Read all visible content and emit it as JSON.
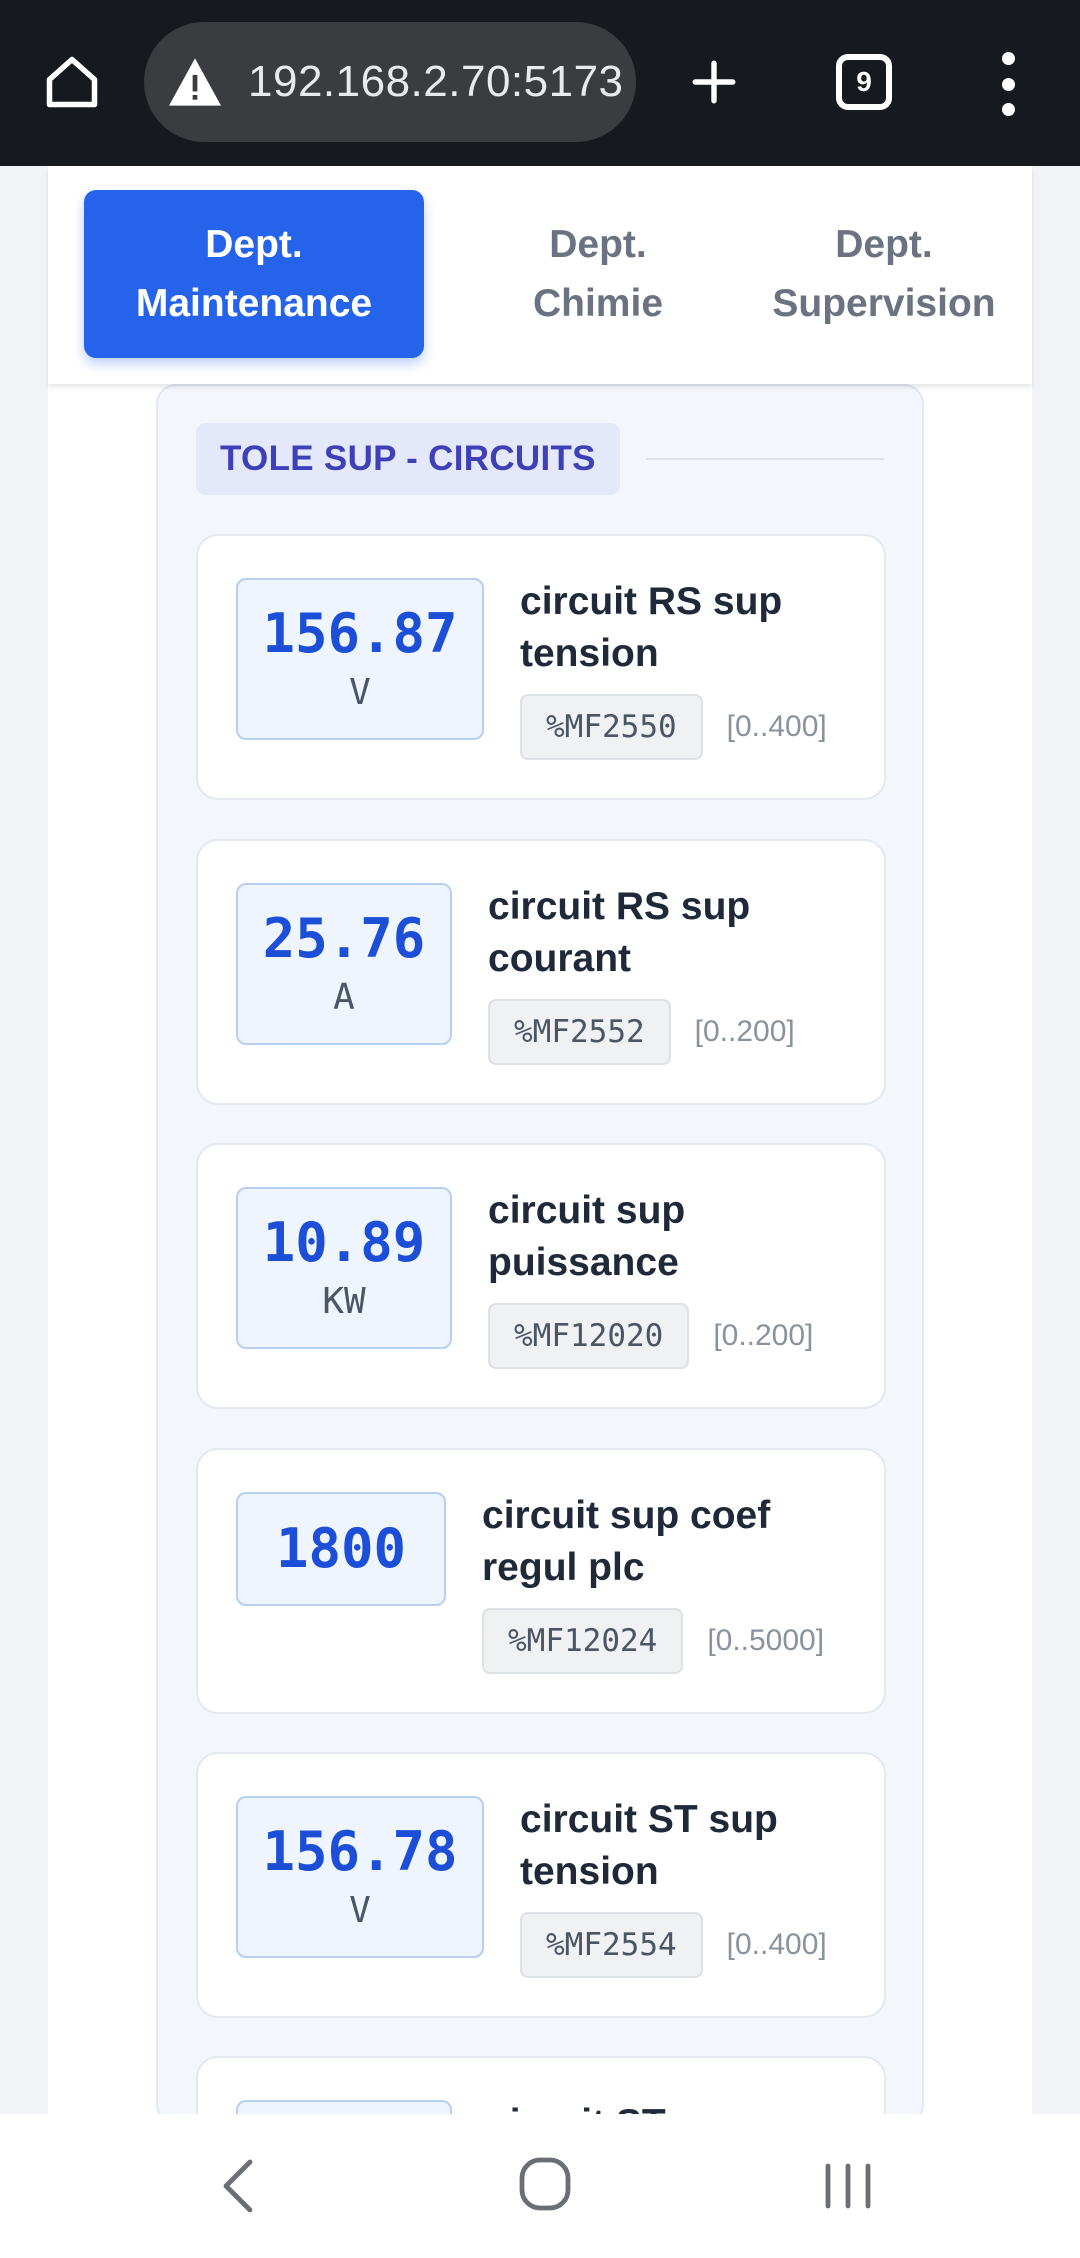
{
  "browser": {
    "url": "192.168.2.70:5173",
    "tab_count": "9",
    "icons": [
      "home-icon",
      "warning-icon",
      "plus-icon",
      "tabs-icon",
      "more-vert-icon"
    ]
  },
  "departments": [
    {
      "label": "Dept.\nMaintenance",
      "active": true
    },
    {
      "label": "Dept.\nChimie",
      "active": false
    },
    {
      "label": "Dept.\nSupervision",
      "active": false
    }
  ],
  "section": {
    "title": "TOLE SUP - CIRCUITS",
    "readings": [
      {
        "value": "156.87",
        "unit": "V",
        "name": "circuit RS sup tension",
        "address": "%MF2550",
        "range": "[0..400]"
      },
      {
        "value": "25.76",
        "unit": "A",
        "name": "circuit RS sup courant",
        "address": "%MF2552",
        "range": "[0..200]"
      },
      {
        "value": "10.89",
        "unit": "KW",
        "name": "circuit sup puissance",
        "address": "%MF12020",
        "range": "[0..200]"
      },
      {
        "value": "1800",
        "unit": "",
        "name": "circuit sup coef regul plc",
        "address": "%MF12024",
        "range": "[0..5000]"
      },
      {
        "value": "156.78",
        "unit": "V",
        "name": "circuit ST sup tension",
        "address": "%MF2554",
        "range": "[0..400]"
      },
      {
        "value": "",
        "unit": "",
        "name": "circuit ST",
        "address": "",
        "range": ""
      }
    ]
  },
  "colors": {
    "accent": "#2563eb",
    "value_text": "#1d4ed8",
    "badge_text": "#3f3fb8",
    "chrome_bg": "#16191d"
  },
  "system_nav": [
    "back-icon",
    "home-circle-icon",
    "recent-apps-icon"
  ]
}
